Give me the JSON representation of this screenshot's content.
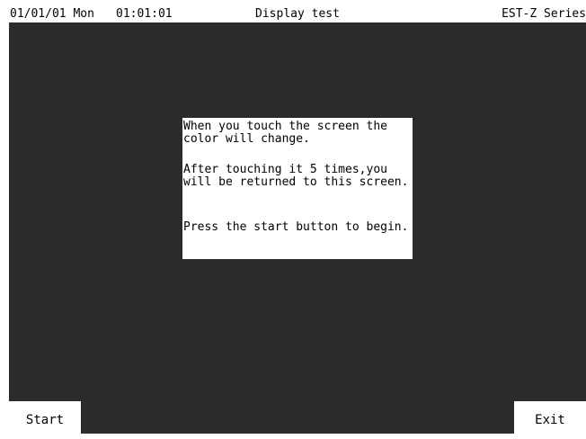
{
  "status_bar": {
    "date": "01/01/01 Mon",
    "time": "01:01:01",
    "title": "Display test",
    "brand": "EST-Z Series"
  },
  "dialog": {
    "message_1": "When you touch the screen the\ncolor will change.",
    "message_2": "After touching it 5 times,you\nwill be returned to this screen.",
    "message_3": "Press the start button to begin."
  },
  "buttons": {
    "start_label": "Start",
    "exit_label": "Exit"
  },
  "colors": {
    "screen_background": "#2b2b2b",
    "panel": "#ffffff",
    "text": "#000000"
  }
}
